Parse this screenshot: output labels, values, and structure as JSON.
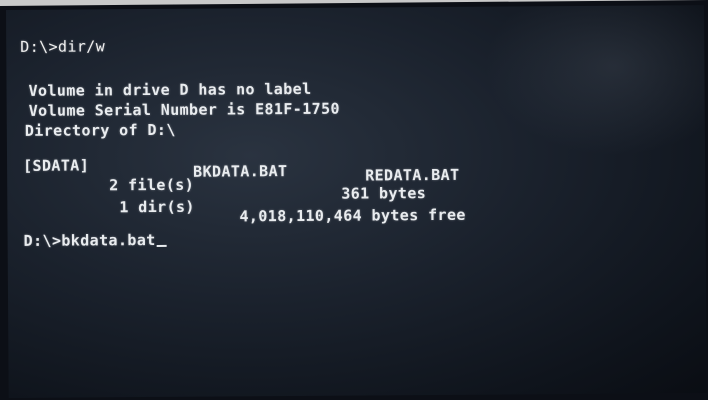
{
  "terminal": {
    "command_1": "D:\\>dir/w",
    "volume_label_line": "Volume in drive D has no label",
    "volume_serial_line": "Volume Serial Number is E81F-1750",
    "directory_line": "Directory of D:\\",
    "entries": [
      "[SDATA]",
      "BKDATA.BAT",
      "REDATA.BAT"
    ],
    "files_count": "2 file(s)",
    "files_bytes": "361 bytes",
    "dirs_count": "1 dir(s)",
    "dirs_free": "4,018,110,464 bytes free",
    "command_2": "D:\\>bkdata.bat"
  },
  "colors": {
    "screen_background": "#1a212c",
    "text": "#e9ecef"
  }
}
